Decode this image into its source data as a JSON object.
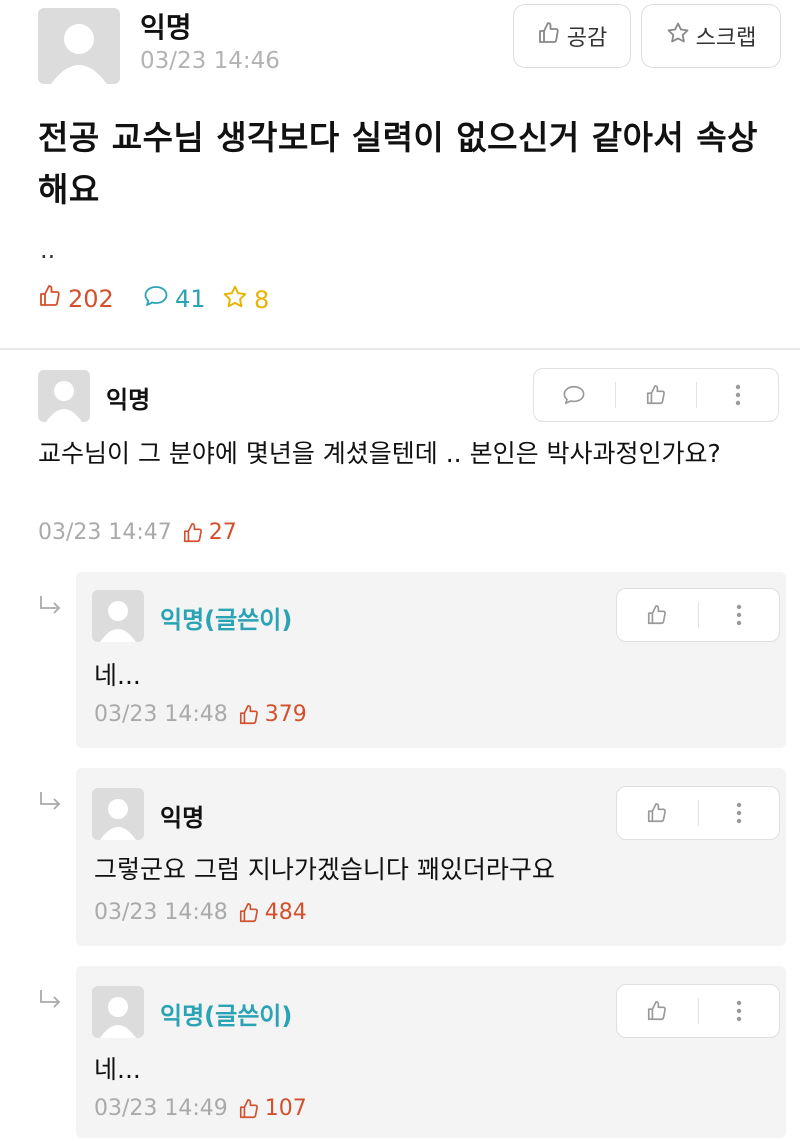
{
  "post": {
    "author": "익명",
    "date": "03/23 14:46",
    "like_btn": "공감",
    "scrap_btn": "스크랩",
    "title": "전공 교수님 생각보다 실력이 없으신거 같아서 속상해요",
    "body": "..",
    "stats": {
      "likes": "202",
      "comments": "41",
      "scraps": "8"
    }
  },
  "comments": [
    {
      "author": "익명",
      "text": "교수님이 그 분야에 몇년을 계셨을텐데 .. 본인은 박사과정인가요?",
      "date": "03/23 14:47",
      "likes": "27"
    }
  ],
  "replies": [
    {
      "author": "익명(글쓴이)",
      "text": "네...",
      "date": "03/23 14:48",
      "likes": "379"
    },
    {
      "author": "익명",
      "text": "그렇군요 그럼 지나가겠습니다 꽤있더라구요",
      "date": "03/23 14:48",
      "likes": "484"
    },
    {
      "author": "익명(글쓴이)",
      "text": "네...",
      "date": "03/23 14:49",
      "likes": "107"
    }
  ],
  "colors": {
    "like": "#d2502d",
    "comment": "#2aa3b5",
    "scrap": "#e8b400",
    "author": "#2aa3b5"
  }
}
